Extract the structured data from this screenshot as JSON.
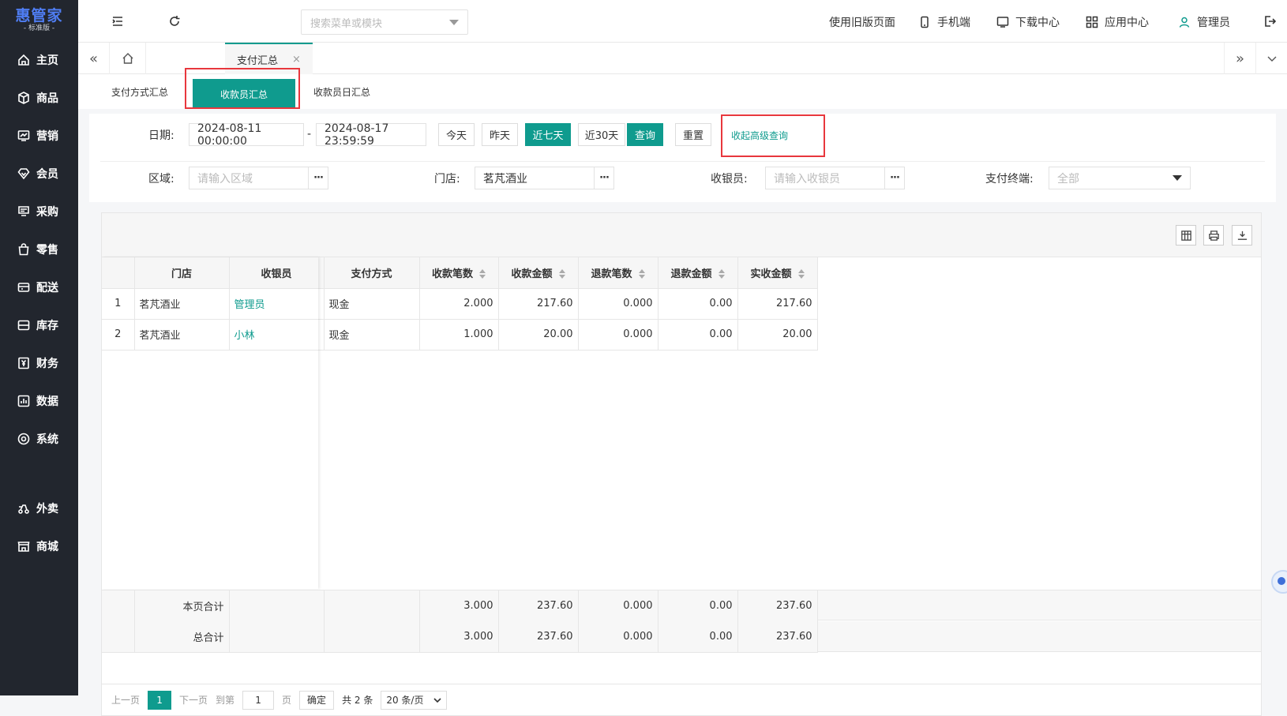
{
  "sidebar": {
    "logo_title": "惠管家",
    "logo_sub": "- 标准版 -",
    "items": [
      {
        "label": "主页",
        "icon": "home-icon"
      },
      {
        "label": "商品",
        "icon": "box-icon"
      },
      {
        "label": "营销",
        "icon": "chart-icon"
      },
      {
        "label": "会员",
        "icon": "diamond-icon"
      },
      {
        "label": "采购",
        "icon": "purchase-icon"
      },
      {
        "label": "零售",
        "icon": "bag-icon"
      },
      {
        "label": "配送",
        "icon": "delivery-icon"
      },
      {
        "label": "库存",
        "icon": "inventory-icon"
      },
      {
        "label": "财务",
        "icon": "finance-icon"
      },
      {
        "label": "数据",
        "icon": "data-icon"
      },
      {
        "label": "系统",
        "icon": "settings-icon"
      },
      {
        "label": "外卖",
        "icon": "takeout-icon"
      },
      {
        "label": "商城",
        "icon": "store-icon"
      }
    ]
  },
  "topbar": {
    "search_placeholder": "搜索菜单或模块",
    "old_page": "使用旧版页面",
    "mobile": "手机端",
    "download": "下载中心",
    "apps": "应用中心",
    "user": "管理员"
  },
  "tabs": {
    "active": "支付汇总",
    "close": "×"
  },
  "subtabs": {
    "t1": "支付方式汇总",
    "t2": "收款员汇总",
    "t3": "收款员日汇总"
  },
  "filter": {
    "date_label": "日期:",
    "date_start": "2024-08-11 00:00:00",
    "date_sep": "-",
    "date_end": "2024-08-17 23:59:59",
    "btn_today": "今天",
    "btn_yesterday": "昨天",
    "btn_7": "近七天",
    "btn_30": "近30天",
    "btn_query": "查询",
    "btn_reset": "重置",
    "advanced": "收起高级查询",
    "region_label": "区域:",
    "region_ph": "请输入区域",
    "store_label": "门店:",
    "store_value": "茗芃酒业",
    "cashier_label": "收银员:",
    "cashier_ph": "请输入收银员",
    "terminal_label": "支付终端:",
    "terminal_value": "全部",
    "dots": "···"
  },
  "table": {
    "headers": [
      "门店",
      "收银员",
      "支付方式",
      "收款笔数",
      "收款金额",
      "退款笔数",
      "退款金额",
      "实收金额"
    ],
    "rows": [
      {
        "idx": "1",
        "store": "茗芃酒业",
        "cashier": "管理员",
        "method": "现金",
        "cnt": "2.000",
        "amt": "217.60",
        "rcnt": "0.000",
        "ramt": "0.00",
        "net": "217.60"
      },
      {
        "idx": "2",
        "store": "茗芃酒业",
        "cashier": "小林",
        "method": "现金",
        "cnt": "1.000",
        "amt": "20.00",
        "rcnt": "0.000",
        "ramt": "0.00",
        "net": "20.00"
      }
    ],
    "page_total": {
      "label": "本页合计",
      "cnt": "3.000",
      "amt": "237.60",
      "rcnt": "0.000",
      "ramt": "0.00",
      "net": "237.60"
    },
    "grand_total": {
      "label": "总合计",
      "cnt": "3.000",
      "amt": "237.60",
      "rcnt": "0.000",
      "ramt": "0.00",
      "net": "237.60"
    }
  },
  "pager": {
    "prev": "上一页",
    "page": "1",
    "next": "下一页",
    "goto": "到第",
    "goto_val": "1",
    "page_unit": "页",
    "confirm": "确定",
    "total": "共 2 条",
    "per_page": "20 条/页"
  }
}
